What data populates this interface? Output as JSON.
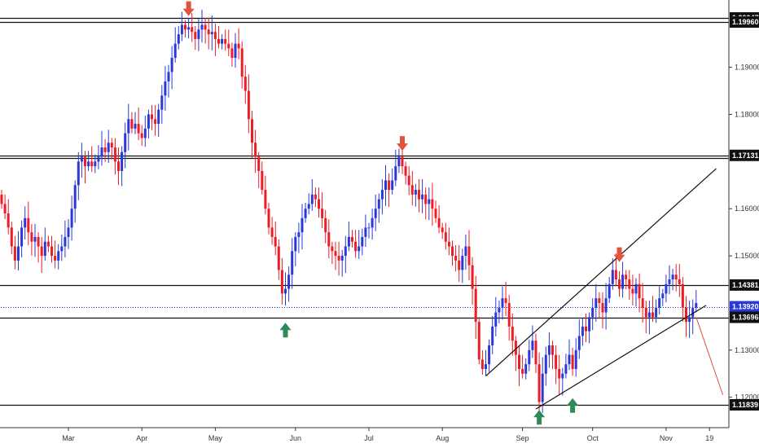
{
  "chart_data": {
    "type": "candlestick",
    "title": "",
    "xlabel": "",
    "ylabel": "",
    "ylim": [
      1.1155,
      1.205
    ],
    "price_ticks": [
      "1.19000",
      "1.18000",
      "1.16000",
      "1.15000",
      "1.13000",
      "1.12000"
    ],
    "month_labels": [
      {
        "label": "Mar",
        "index": 20
      },
      {
        "label": "Apr",
        "index": 42
      },
      {
        "label": "May",
        "index": 64
      },
      {
        "label": "Jun",
        "index": 88
      },
      {
        "label": "Jul",
        "index": 110
      },
      {
        "label": "Aug",
        "index": 132
      },
      {
        "label": "Sep",
        "index": 156
      },
      {
        "label": "Oct",
        "index": 177
      },
      {
        "label": "Nov",
        "index": 199
      },
      {
        "label": "19",
        "index": 212
      }
    ],
    "horizontal_levels": [
      {
        "value": 1.20047,
        "label": "1.20047",
        "style": "black"
      },
      {
        "value": 1.1996,
        "label": "1.19960",
        "style": "black"
      },
      {
        "value": 1.17131,
        "label": "1.17131",
        "style": "black"
      },
      {
        "value": 1.1708,
        "label": "",
        "style": "black"
      },
      {
        "value": 1.14381,
        "label": "1.14381",
        "style": "black"
      },
      {
        "value": 1.1392,
        "label": "1.13920",
        "style": "blue-dotted"
      },
      {
        "value": 1.13696,
        "label": "1.13696",
        "style": "black"
      },
      {
        "value": 1.11839,
        "label": "1.11839",
        "style": "black"
      }
    ],
    "trend_lines": [
      {
        "from": [
          145,
          1.1245
        ],
        "to": [
          214,
          1.1685
        ]
      },
      {
        "from": [
          160,
          1.1175
        ],
        "to": [
          211,
          1.1395
        ]
      }
    ],
    "projection_line": {
      "from": [
        208,
        1.137
      ],
      "to": [
        216,
        1.1205
      ]
    },
    "arrows": [
      {
        "index": 56,
        "price": 1.2002,
        "direction": "down",
        "color": "#e0533c"
      },
      {
        "index": 120,
        "price": 1.1716,
        "direction": "down",
        "color": "#e0533c"
      },
      {
        "index": 185,
        "price": 1.148,
        "direction": "down",
        "color": "#e0533c"
      },
      {
        "index": 85,
        "price": 1.1365,
        "direction": "up",
        "color": "#2e8b57"
      },
      {
        "index": 161,
        "price": 1.118,
        "direction": "up",
        "color": "#2e8b57"
      },
      {
        "index": 171,
        "price": 1.1205,
        "direction": "up",
        "color": "#2e8b57"
      }
    ],
    "colors": {
      "up": "#2a39d6",
      "down": "#ee1c25",
      "blue_level": "#2a39d6",
      "text": "#333333"
    },
    "closes": [
      1.161,
      1.159,
      1.156,
      1.152,
      1.149,
      1.152,
      1.156,
      1.158,
      1.155,
      1.153,
      1.154,
      1.152,
      1.15,
      1.153,
      1.152,
      1.15,
      1.149,
      1.151,
      1.152,
      1.154,
      1.156,
      1.16,
      1.165,
      1.17,
      1.171,
      1.169,
      1.17,
      1.169,
      1.17,
      1.171,
      1.173,
      1.172,
      1.174,
      1.173,
      1.17,
      1.168,
      1.172,
      1.176,
      1.179,
      1.177,
      1.178,
      1.176,
      1.175,
      1.177,
      1.18,
      1.179,
      1.178,
      1.181,
      1.184,
      1.187,
      1.189,
      1.192,
      1.195,
      1.197,
      1.199,
      1.198,
      1.1985,
      1.1975,
      1.196,
      1.198,
      1.199,
      1.198,
      1.197,
      1.1975,
      1.196,
      1.195,
      1.196,
      1.195,
      1.194,
      1.192,
      1.195,
      1.194,
      1.188,
      1.185,
      1.179,
      1.174,
      1.171,
      1.168,
      1.164,
      1.16,
      1.156,
      1.154,
      1.152,
      1.147,
      1.142,
      1.143,
      1.146,
      1.151,
      1.154,
      1.155,
      1.158,
      1.16,
      1.161,
      1.163,
      1.162,
      1.16,
      1.158,
      1.155,
      1.152,
      1.151,
      1.15,
      1.149,
      1.15,
      1.152,
      1.154,
      1.153,
      1.151,
      1.152,
      1.154,
      1.156,
      1.156,
      1.158,
      1.16,
      1.162,
      1.164,
      1.166,
      1.164,
      1.166,
      1.169,
      1.171,
      1.169,
      1.167,
      1.165,
      1.163,
      1.164,
      1.162,
      1.163,
      1.161,
      1.162,
      1.16,
      1.158,
      1.156,
      1.155,
      1.153,
      1.152,
      1.15,
      1.149,
      1.147,
      1.15,
      1.152,
      1.148,
      1.143,
      1.136,
      1.128,
      1.126,
      1.127,
      1.131,
      1.135,
      1.138,
      1.139,
      1.141,
      1.14,
      1.135,
      1.132,
      1.129,
      1.126,
      1.125,
      1.127,
      1.13,
      1.132,
      1.127,
      1.119,
      1.125,
      1.129,
      1.131,
      1.129,
      1.126,
      1.124,
      1.125,
      1.127,
      1.129,
      1.126,
      1.13,
      1.133,
      1.135,
      1.134,
      1.137,
      1.139,
      1.141,
      1.14,
      1.138,
      1.141,
      1.144,
      1.147,
      1.145,
      1.143,
      1.146,
      1.145,
      1.143,
      1.142,
      1.144,
      1.141,
      1.139,
      1.137,
      1.138,
      1.137,
      1.139,
      1.141,
      1.142,
      1.144,
      1.145,
      1.146,
      1.145,
      1.144,
      1.139,
      1.136,
      1.137,
      1.139,
      1.14
    ]
  }
}
